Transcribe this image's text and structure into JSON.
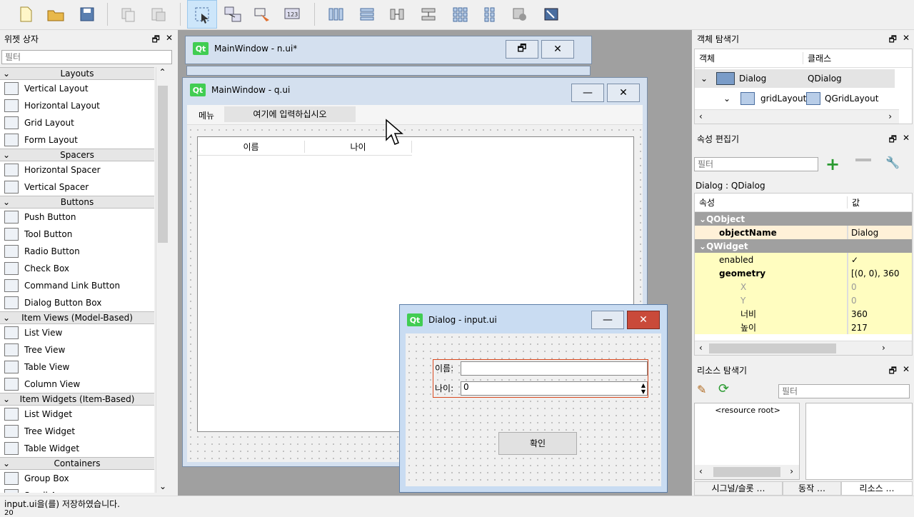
{
  "toolbar": {
    "icons": [
      "new-file-icon",
      "open-folder-icon",
      "save-icon",
      "copy-icon",
      "paste-icon",
      "edit-widgets-icon",
      "edit-signals-icon",
      "edit-buddies-icon",
      "edit-tab-order-icon",
      "layout-horizontal-icon",
      "layout-vertical-icon",
      "layout-horizontal-splitter-icon",
      "layout-vertical-splitter-icon",
      "layout-grid-icon",
      "layout-form-icon",
      "break-layout-icon",
      "adjust-size-icon"
    ]
  },
  "widget_box": {
    "title": "위젯 상자",
    "filter_placeholder": "필터",
    "categories": [
      {
        "label": "Layouts",
        "items": [
          "Vertical Layout",
          "Horizontal Layout",
          "Grid Layout",
          "Form Layout"
        ]
      },
      {
        "label": "Spacers",
        "items": [
          "Horizontal Spacer",
          "Vertical Spacer"
        ]
      },
      {
        "label": "Buttons",
        "items": [
          "Push Button",
          "Tool Button",
          "Radio Button",
          "Check Box",
          "Command Link Button",
          "Dialog Button Box"
        ]
      },
      {
        "label": "Item Views (Model-Based)",
        "items": [
          "List View",
          "Tree View",
          "Table View",
          "Column View"
        ]
      },
      {
        "label": "Item Widgets (Item-Based)",
        "items": [
          "List Widget",
          "Tree Widget",
          "Table Widget"
        ]
      },
      {
        "label": "Containers",
        "items": [
          "Group Box",
          "Scroll Area"
        ]
      }
    ]
  },
  "windows": {
    "back": {
      "title": "MainWindow - n.ui*"
    },
    "main": {
      "title": "MainWindow - q.ui",
      "menu_item": "메뉴",
      "menu_placeholder": "여기에 입력하십시오",
      "columns": [
        "이름",
        "나이"
      ]
    },
    "dialog": {
      "title": "Dialog - input.ui",
      "name_label": "이름:",
      "age_label": "나이:",
      "name_value": "",
      "age_value": "0",
      "ok_label": "확인"
    }
  },
  "object_inspector": {
    "title": "객체 탐색기",
    "col_object": "객체",
    "col_class": "클래스",
    "rows": [
      {
        "object": "Dialog",
        "class": "QDialog"
      },
      {
        "object": "gridLayout",
        "class": "QGridLayout"
      }
    ]
  },
  "property_editor": {
    "title": "속성 편집기",
    "filter_placeholder": "필터",
    "context": "Dialog : QDialog",
    "col_property": "속성",
    "col_value": "값",
    "rows": [
      {
        "kind": "section",
        "name": "QObject",
        "value": ""
      },
      {
        "kind": "prop",
        "name": "objectName",
        "value": "Dialog",
        "bold": true
      },
      {
        "kind": "section",
        "name": "QWidget",
        "value": ""
      },
      {
        "kind": "prop",
        "name": "enabled",
        "value": "✓"
      },
      {
        "kind": "prop",
        "name": "geometry",
        "value": "[(0, 0), 360",
        "bold": true
      },
      {
        "kind": "sub",
        "name": "X",
        "value": "0"
      },
      {
        "kind": "sub",
        "name": "Y",
        "value": "0"
      },
      {
        "kind": "sub",
        "name": "너비",
        "value": "360"
      },
      {
        "kind": "sub",
        "name": "높이",
        "value": "217"
      }
    ]
  },
  "resource_browser": {
    "title": "리소스 탐색기",
    "filter_placeholder": "필터",
    "root": "<resource root>",
    "tabs": [
      "시그널/슬롯 …",
      "동작 …",
      "리소스 …"
    ]
  },
  "status": {
    "message": "input.ui을(를) 저장하였습니다.",
    "zoom": "20"
  }
}
